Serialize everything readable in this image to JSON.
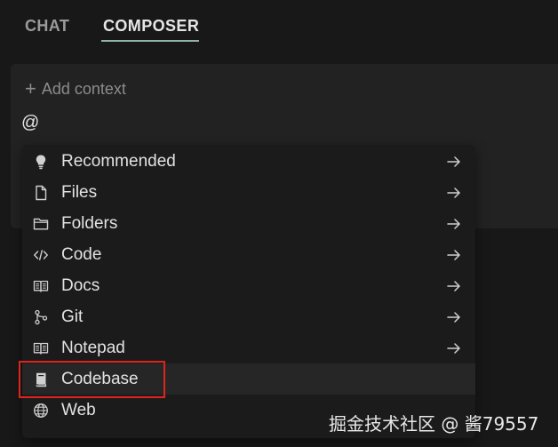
{
  "tabs": {
    "chat": "CHAT",
    "composer": "COMPOSER",
    "active": "COMPOSER"
  },
  "composer": {
    "add_context_label": "Add context",
    "input_text": "@"
  },
  "menu": {
    "items": [
      {
        "label": "Recommended",
        "icon": "lightbulb-icon",
        "has_arrow": true
      },
      {
        "label": "Files",
        "icon": "file-icon",
        "has_arrow": true
      },
      {
        "label": "Folders",
        "icon": "folder-icon",
        "has_arrow": true
      },
      {
        "label": "Code",
        "icon": "code-icon",
        "has_arrow": true
      },
      {
        "label": "Docs",
        "icon": "book-icon",
        "has_arrow": true
      },
      {
        "label": "Git",
        "icon": "git-branch-icon",
        "has_arrow": true
      },
      {
        "label": "Notepad",
        "icon": "notepad-icon",
        "has_arrow": true
      },
      {
        "label": "Codebase",
        "icon": "codebase-icon",
        "has_arrow": false
      },
      {
        "label": "Web",
        "icon": "globe-icon",
        "has_arrow": false
      }
    ],
    "selected_label": "Codebase"
  },
  "annotation": {
    "highlight_color": "#e0241b"
  },
  "watermark": "掘金技术社区 @ 酱79557",
  "colors": {
    "background": "#181818",
    "panel": "#222222",
    "accent_underline": "#8fb3a2"
  }
}
